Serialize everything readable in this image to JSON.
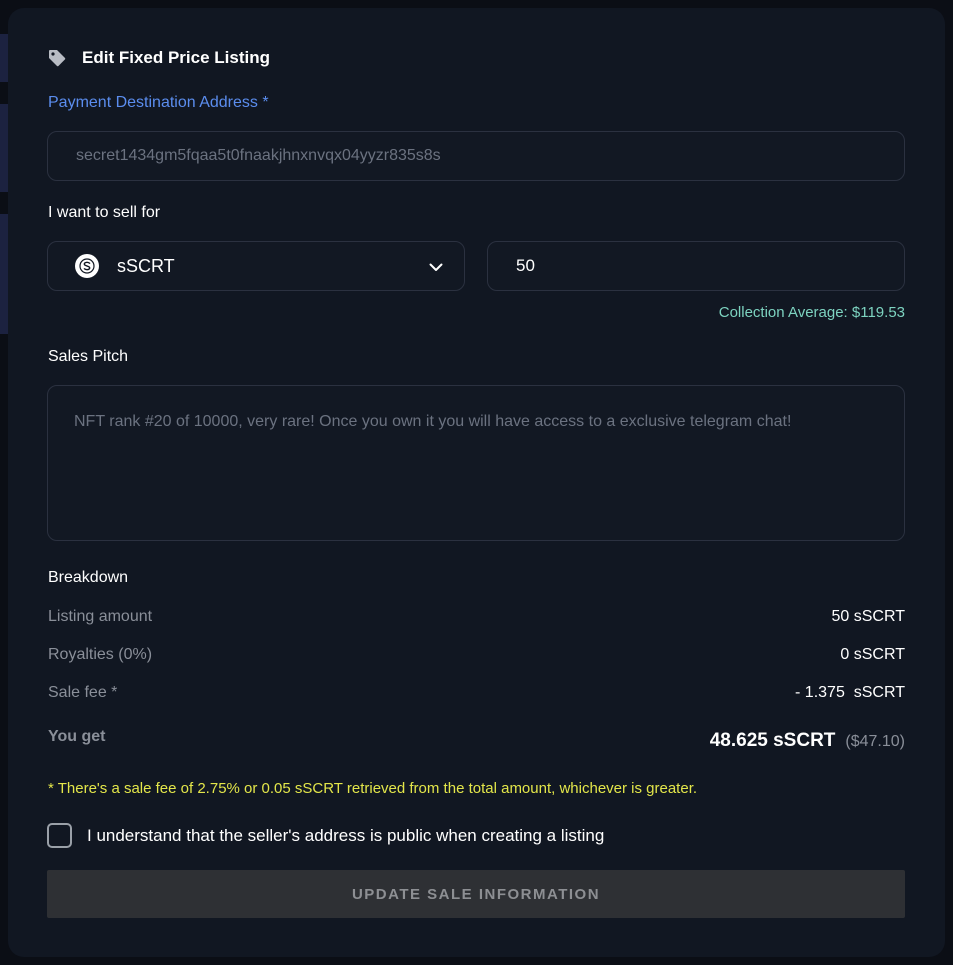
{
  "header": {
    "title": "Edit Fixed Price Listing",
    "icon": "tag-icon"
  },
  "payment": {
    "label": "Payment Destination Address *",
    "address": "secret1434gm5fqaa5t0fnaakjhnxnvqx04yyzr835s8s"
  },
  "sell": {
    "label": "I want to sell for",
    "token": "sSCRT",
    "token_icon": "secret-token-icon",
    "amount": "50",
    "collection_average": "Collection Average: $119.53"
  },
  "pitch": {
    "label": "Sales Pitch",
    "text": "NFT rank #20 of 10000, very rare! Once you own it you will have access to a exclusive telegram chat!"
  },
  "breakdown": {
    "heading": "Breakdown",
    "rows": [
      {
        "label": "Listing amount",
        "value": "50 sSCRT"
      },
      {
        "label": "Royalties (0%)",
        "value": "0 sSCRT"
      },
      {
        "label": "Sale fee *",
        "value": "- 1.375  sSCRT"
      }
    ],
    "you_get_label": "You get",
    "you_get_value": "48.625 sSCRT",
    "you_get_usd": "($47.10)",
    "fee_note": "* There's a sale fee of 2.75% or 0.05 sSCRT retrieved from the total amount, whichever is greater."
  },
  "agreement": {
    "label": "I understand that the seller's address is public when creating a listing",
    "checked": false
  },
  "submit_label": "UPDATE SALE INFORMATION",
  "colors": {
    "accent_blue": "#5b8dee",
    "teal": "#7dd3c0",
    "note_yellow": "#e3e64a",
    "panel": "#111722"
  }
}
